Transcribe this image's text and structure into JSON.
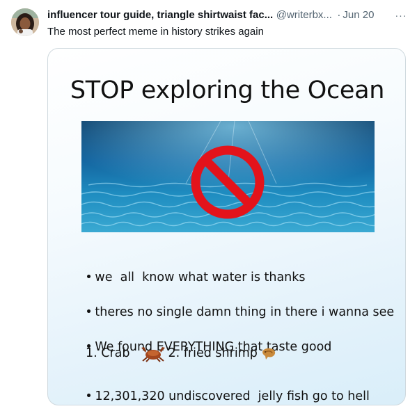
{
  "tweet": {
    "author_name": "influencer tour guide, triangle shirtwaist fac...",
    "handle": "@writerbx...",
    "separator": "·",
    "date": "Jun 20",
    "more_label": "···",
    "text": "The most perfect meme in history strikes again"
  },
  "meme": {
    "title": "STOP exploring the Ocean",
    "icons": [
      "no-symbol-icon",
      "crab-icon",
      "shrimp-icon"
    ],
    "bullet_char": "•",
    "bullets": [
      "we  all  know what water is thanks",
      "theres no single damn thing in there i wanna see",
      "We found EVERYTHING that taste good",
      "12,301,320 undiscovered  jelly fish go to hell"
    ],
    "list_items": [
      "1. Crab",
      "2. fried shrimp"
    ]
  },
  "colors": {
    "no_symbol": "#e3131b",
    "ocean_deep": "#0b3f6b",
    "ocean_light": "#2b9bc8"
  }
}
